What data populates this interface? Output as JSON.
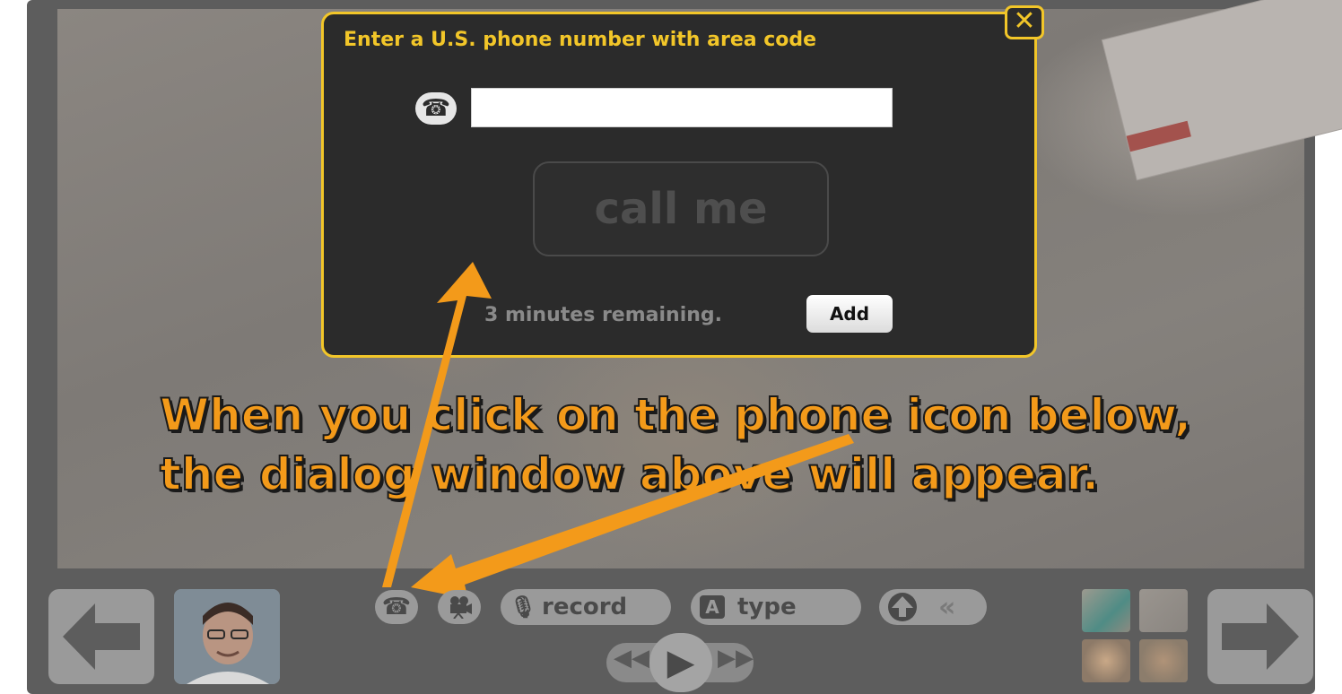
{
  "dialog": {
    "title": "Enter a U.S. phone number with area code",
    "close_label": "✕",
    "phone_value": "",
    "call_button_label": "call me",
    "remaining_text": "3 minutes remaining.",
    "add_button_label": "Add"
  },
  "caption": {
    "line1": "When you click on the phone icon below,",
    "line2": "the dialog window above will appear."
  },
  "toolbar": {
    "back_label": "←",
    "forward_label": "→",
    "phone_icon": "phone-icon",
    "video_icon": "video-camera-icon",
    "record_label": "record",
    "type_label": "type",
    "type_icon_letter": "A",
    "upload_icon": "upload-arrow-icon",
    "collapse_label": "«",
    "rewind_label": "◀◀",
    "play_label": "▶",
    "fastforward_label": "▶▶"
  },
  "colors": {
    "accent_yellow": "#f2c629",
    "caption_orange": "#f39a1a",
    "arrow_orange": "#f39a1a"
  }
}
